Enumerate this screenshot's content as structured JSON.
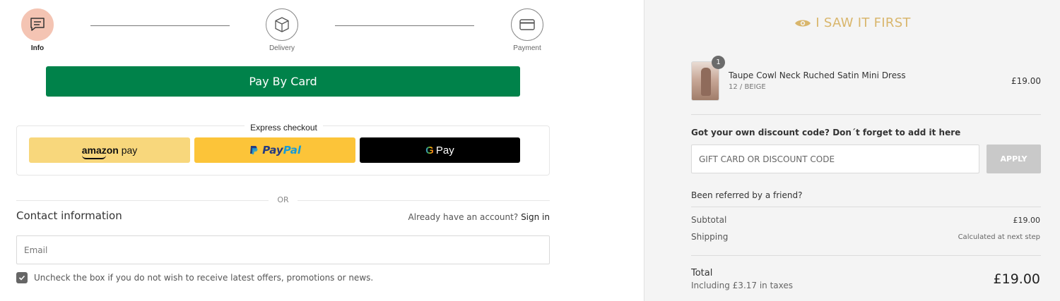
{
  "steps": [
    {
      "label": "Info",
      "icon": "chat-icon",
      "active": true
    },
    {
      "label": "Delivery",
      "icon": "box-icon",
      "active": false
    },
    {
      "label": "Payment",
      "icon": "card-icon",
      "active": false
    }
  ],
  "pay_by_card_label": "Pay By Card",
  "express": {
    "title": "Express checkout",
    "amazon": {
      "text_a": "amazon",
      "text_b": " pay"
    },
    "paypal": {
      "text_a": "Pay",
      "text_b": "Pal"
    },
    "gpay": {
      "g": "G",
      "text": "Pay"
    }
  },
  "or_label": "OR",
  "contact": {
    "title": "Contact information",
    "account_prompt": "Already have an account?",
    "sign_in": "Sign in",
    "email_placeholder": "Email",
    "optin_text": "Uncheck the box if you do not wish to receive latest offers, promotions or news.",
    "optin_checked": true
  },
  "brand": {
    "name": "I SAW IT FIRST",
    "color": "#d9b66c"
  },
  "order": {
    "item": {
      "quantity": "1",
      "name": "Taupe Cowl Neck Ruched Satin Mini Dress",
      "variant": "12 / BEIGE",
      "price": "£19.00"
    },
    "discount_title": "Got your own discount code? Don´t forget to add it here",
    "discount_placeholder": "GIFT CARD OR DISCOUNT CODE",
    "apply_label": "APPLY",
    "referred": "Been referred by a friend?",
    "subtotal_label": "Subtotal",
    "subtotal_value": "£19.00",
    "shipping_label": "Shipping",
    "shipping_value": "Calculated at next step",
    "total_label": "Total",
    "tax_note": "Including £3.17 in taxes",
    "total_value": "£19.00"
  },
  "colors": {
    "accent_green": "#00824a",
    "active_step": "#f4c4b3"
  }
}
